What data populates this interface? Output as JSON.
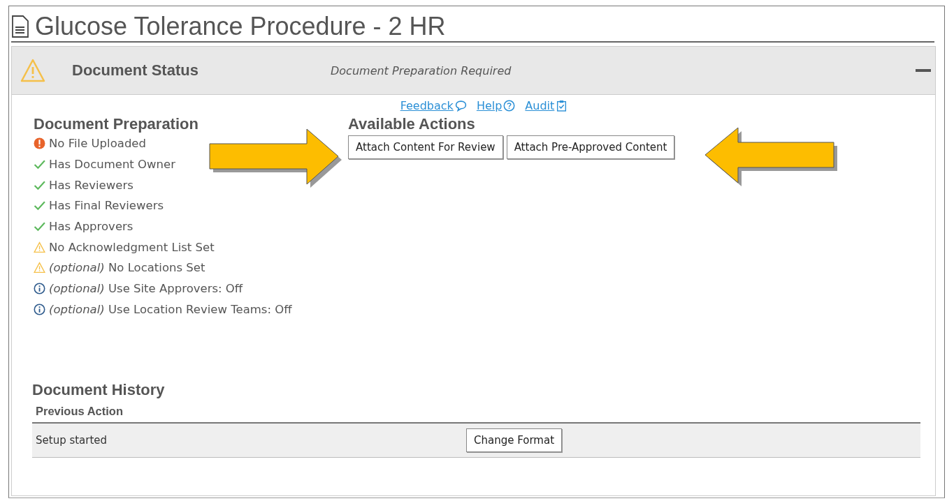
{
  "title": "Glucose Tolerance Procedure - 2 HR",
  "status_panel": {
    "title": "Document Status",
    "status": "Document Preparation Required",
    "expanded": true
  },
  "links": [
    {
      "label": "Feedback",
      "kind": "feedback"
    },
    {
      "label": "Help",
      "kind": "help"
    },
    {
      "label": "Audit",
      "kind": "audit"
    }
  ],
  "preparation": {
    "title": "Document Preparation",
    "items": [
      {
        "kind": "error",
        "text": "No File Uploaded"
      },
      {
        "kind": "ok",
        "text": "Has Document Owner"
      },
      {
        "kind": "ok",
        "text": "Has Reviewers"
      },
      {
        "kind": "ok",
        "text": "Has Final Reviewers"
      },
      {
        "kind": "ok",
        "text": "Has Approvers"
      },
      {
        "kind": "warning",
        "text": "No Acknowledgment List Set"
      },
      {
        "kind": "warning",
        "text": "*(optional)* No Locations Set"
      },
      {
        "kind": "info",
        "text": "*(optional)* Use Site Approvers: Off"
      },
      {
        "kind": "info",
        "text": "*(optional)* Use Location Review Teams: Off"
      }
    ]
  },
  "actions": {
    "title": "Available Actions",
    "buttons": [
      "Attach Content For Review",
      "Attach Pre-Approved Content"
    ]
  },
  "history": {
    "title": "Document History",
    "column": "Previous Action",
    "rows": [
      {
        "action": "Setup started",
        "button": "Change Format"
      }
    ]
  }
}
